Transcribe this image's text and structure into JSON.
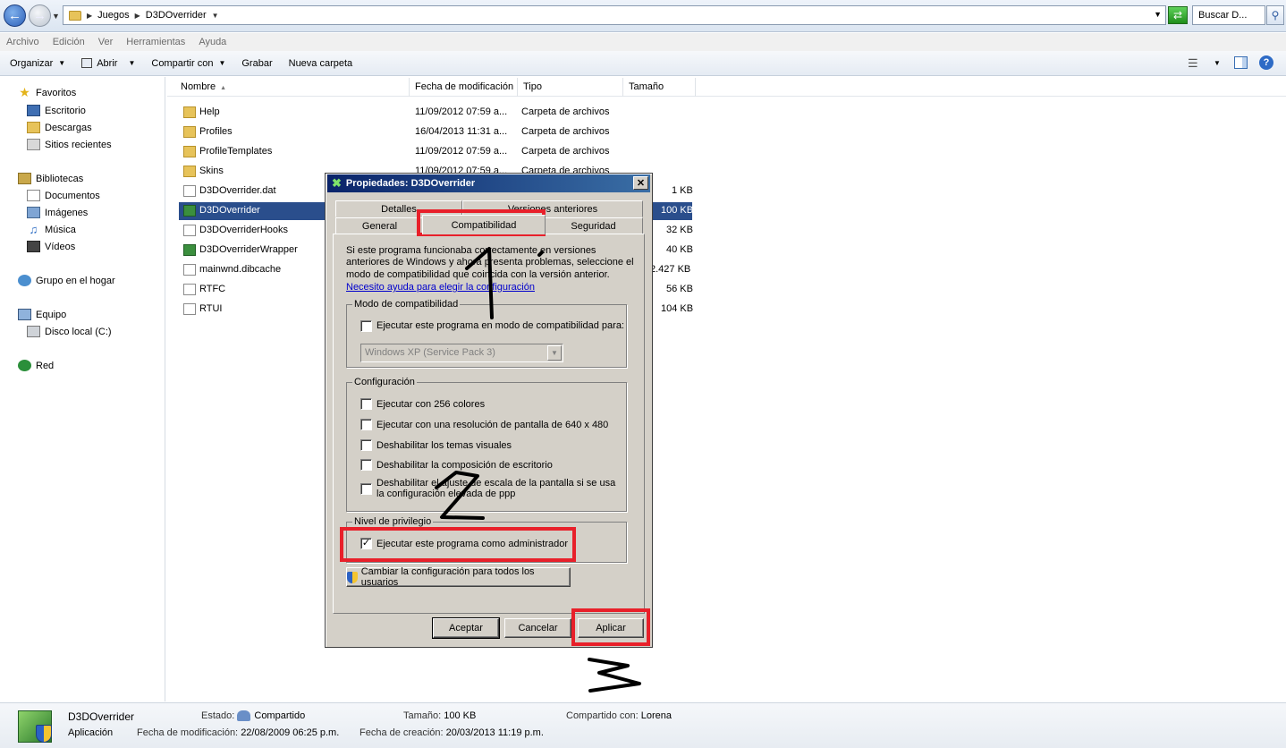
{
  "address": {
    "path": [
      "Juegos",
      "D3DOverrider"
    ],
    "search_placeholder": "Buscar D..."
  },
  "menu": [
    "Archivo",
    "Edición",
    "Ver",
    "Herramientas",
    "Ayuda"
  ],
  "toolbar": {
    "organize": "Organizar",
    "open": "Abrir",
    "share": "Compartir con",
    "burn": "Grabar",
    "new_folder": "Nueva carpeta"
  },
  "nav": {
    "favorites": "Favoritos",
    "desktop": "Escritorio",
    "downloads": "Descargas",
    "recent": "Sitios recientes",
    "libraries": "Bibliotecas",
    "documents": "Documentos",
    "images": "Imágenes",
    "music": "Música",
    "videos": "Vídeos",
    "homegroup": "Grupo en el hogar",
    "computer": "Equipo",
    "local_disk": "Disco local (C:)",
    "network": "Red"
  },
  "columns": {
    "name": "Nombre",
    "modified": "Fecha de modificación",
    "type": "Tipo",
    "size": "Tamaño"
  },
  "files": [
    {
      "name": "Help",
      "modified": "11/09/2012 07:59 a...",
      "type": "Carpeta de archivos",
      "size": "",
      "icon": "folder"
    },
    {
      "name": "Profiles",
      "modified": "16/04/2013 11:31 a...",
      "type": "Carpeta de archivos",
      "size": "",
      "icon": "folder"
    },
    {
      "name": "ProfileTemplates",
      "modified": "11/09/2012 07:59 a...",
      "type": "Carpeta de archivos",
      "size": "",
      "icon": "folder"
    },
    {
      "name": "Skins",
      "modified": "11/09/2012 07:59 a...",
      "type": "Carpeta de archivos",
      "size": "",
      "icon": "folder"
    },
    {
      "name": "D3DOverrider.dat",
      "modified": "",
      "type": "",
      "size": "1 KB",
      "icon": "file"
    },
    {
      "name": "D3DOverrider",
      "modified": "",
      "type": "",
      "size": "100 KB",
      "icon": "app"
    },
    {
      "name": "D3DOverriderHooks",
      "modified": "",
      "type": "",
      "size": "32 KB",
      "icon": "file"
    },
    {
      "name": "D3DOverriderWrapper",
      "modified": "",
      "type": "",
      "size": "40 KB",
      "icon": "app"
    },
    {
      "name": "mainwnd.dibcache",
      "modified": "",
      "type": "",
      "size": "2.427 KB",
      "icon": "file"
    },
    {
      "name": "RTFC",
      "modified": "",
      "type": "",
      "size": "56 KB",
      "icon": "file"
    },
    {
      "name": "RTUI",
      "modified": "",
      "type": "",
      "size": "104 KB",
      "icon": "file"
    }
  ],
  "details": {
    "name": "D3DOverrider",
    "kind": "Aplicación",
    "state_label": "Estado:",
    "state_value": "Compartido",
    "size_label": "Tamaño:",
    "size_value": "100 KB",
    "shared_label": "Compartido con:",
    "shared_value": "Lorena",
    "modified_label": "Fecha de modificación:",
    "modified_value": "22/08/2009 06:25 p.m.",
    "created_label": "Fecha de creación:",
    "created_value": "20/03/2013 11:19 p.m."
  },
  "dialog": {
    "title": "Propiedades: D3DOverrider",
    "tabs_back": [
      "Detalles",
      "Versiones anteriores"
    ],
    "tabs_front": [
      "General",
      "Compatibilidad",
      "Seguridad"
    ],
    "active_tab": "Compatibilidad",
    "intro": "Si este programa funcionaba correctamente en versiones anteriores de Windows y ahora presenta problemas, seleccione el modo de compatibilidad que coincida con la versión anterior.",
    "help_link": "Necesito ayuda para elegir la configuración",
    "compat_group": "Modo de compatibilidad",
    "compat_check": "Ejecutar este programa en modo de compatibilidad para:",
    "compat_combo": "Windows XP (Service Pack 3)",
    "config_group": "Configuración",
    "config_checks": [
      "Ejecutar con 256 colores",
      "Ejecutar con una resolución de pantalla de 640 x 480",
      "Deshabilitar los temas visuales",
      "Deshabilitar la composición de escritorio",
      "Deshabilitar el ajuste de escala de la pantalla si se usa la configuración elevada de ppp"
    ],
    "priv_group": "Nivel de privilegio",
    "admin_check": "Ejecutar este programa como administrador",
    "admin_checked": true,
    "all_users_button": "Cambiar la configuración para todos los usuarios",
    "ok": "Aceptar",
    "cancel": "Cancelar",
    "apply": "Aplicar"
  },
  "colors": {
    "annotation_red": "#e8202a",
    "selection": "#2a4e8c",
    "dialog_face": "#d4d0c8"
  }
}
